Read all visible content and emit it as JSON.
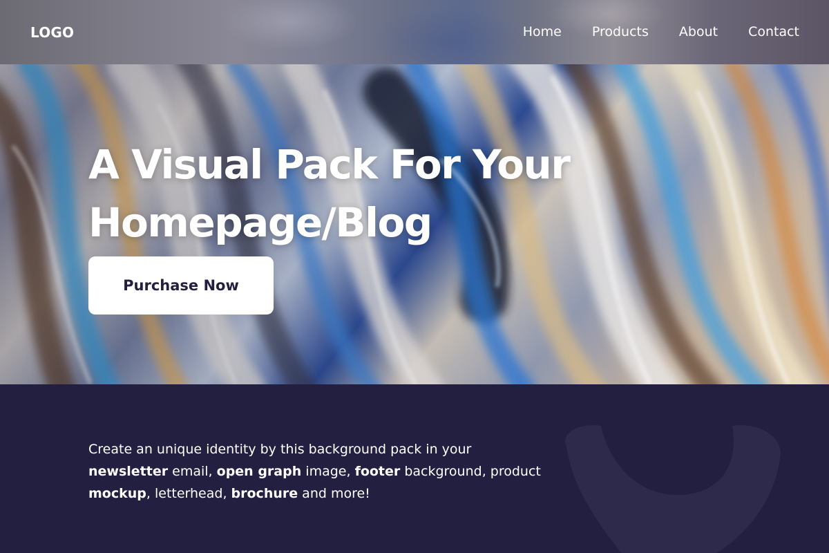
{
  "header": {
    "logo": "LOGO",
    "nav": [
      "Home",
      "Products",
      "About",
      "Contact"
    ]
  },
  "hero": {
    "title_line1": "A Visual Pack For Your",
    "title_line2": "Homepage/Blog",
    "cta_label": "Purchase Now"
  },
  "about": {
    "segments": [
      {
        "text": "Create an unique identity by this background pack in your",
        "bold": false
      },
      {
        "text": "newsletter",
        "bold": true
      },
      {
        "text": " email, ",
        "bold": false
      },
      {
        "text": "open graph",
        "bold": true
      },
      {
        "text": " image, ",
        "bold": false
      },
      {
        "text": "footer",
        "bold": true
      },
      {
        "text": " background, product",
        "bold": false
      },
      {
        "text": "mockup",
        "bold": true
      },
      {
        "text": ", letterhead, ",
        "bold": false
      },
      {
        "text": "brochure",
        "bold": true
      },
      {
        "text": " and more!",
        "bold": false
      }
    ]
  },
  "colors": {
    "dark_navy": "#231f40",
    "button_bg": "#ffffff",
    "button_text": "#231f3f",
    "watermark": "#2e2a4c"
  }
}
